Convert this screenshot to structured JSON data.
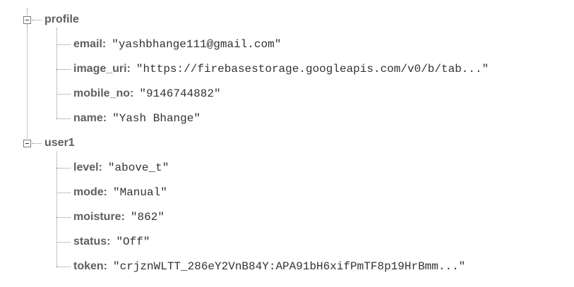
{
  "tree": {
    "nodes": [
      {
        "key": "profile",
        "children": [
          {
            "key": "email",
            "value": "\"yashbhange111@gmail.com\""
          },
          {
            "key": "image_uri",
            "value": "\"https://firebasestorage.googleapis.com/v0/b/tab...\""
          },
          {
            "key": "mobile_no",
            "value": "\"9146744882\""
          },
          {
            "key": "name",
            "value": "\"Yash Bhange\""
          }
        ]
      },
      {
        "key": "user1",
        "children": [
          {
            "key": "level",
            "value": "\"above_t\""
          },
          {
            "key": "mode",
            "value": "\"Manual\""
          },
          {
            "key": "moisture",
            "value": "\"862\""
          },
          {
            "key": "status",
            "value": "\"Off\""
          },
          {
            "key": "token",
            "value": "\"crjznWLTT_286eY2VnB84Y:APA91bH6xifPmTF8p19HrBmm...\""
          }
        ]
      }
    ],
    "toggle_icon": "collapse-minus-icon"
  }
}
